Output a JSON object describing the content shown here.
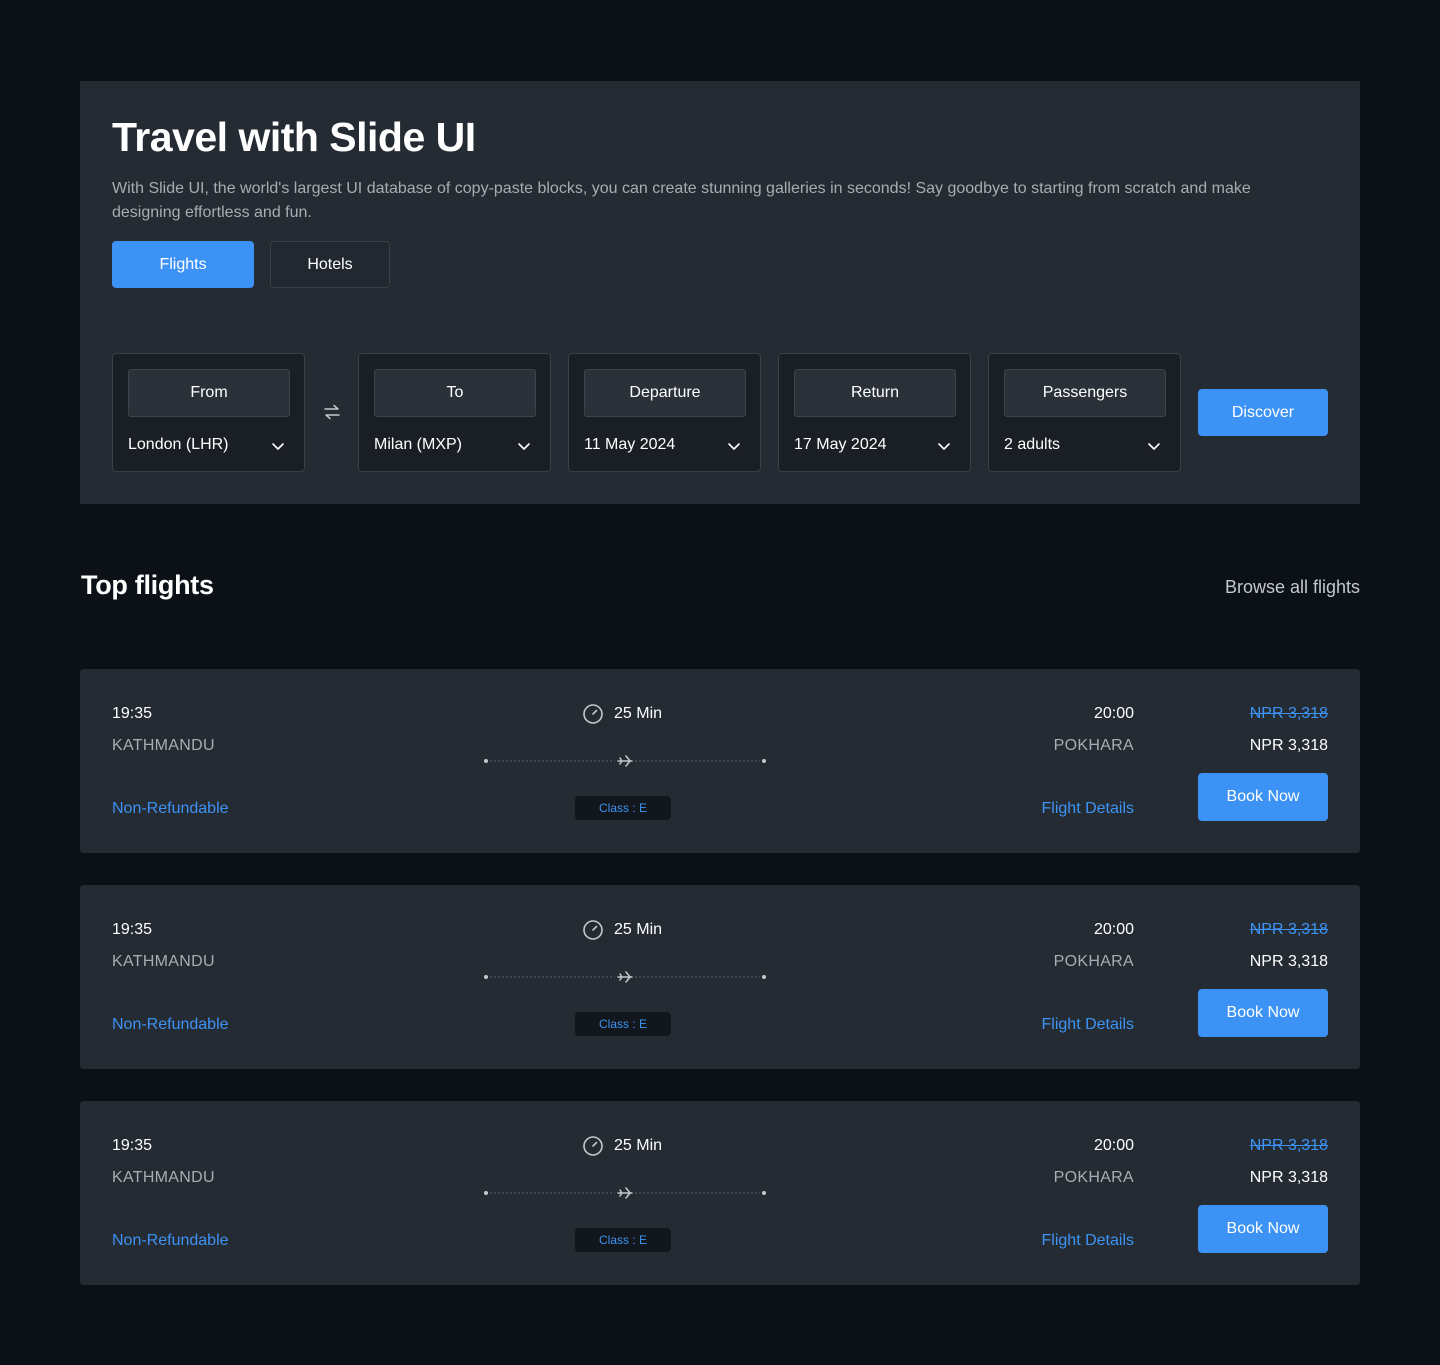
{
  "hero": {
    "title": "Travel with Slide UI",
    "description": "With Slide UI, the world's largest UI database of copy-paste blocks, you can create stunning galleries in seconds! Say goodbye to starting from scratch and make designing effortless and fun.",
    "tabs": [
      {
        "label": "Flights",
        "active": true
      },
      {
        "label": "Hotels",
        "active": false
      }
    ]
  },
  "search": {
    "fields": [
      {
        "label": "From",
        "value": "London (LHR)"
      },
      {
        "label": "To",
        "value": "Milan (MXP)"
      },
      {
        "label": "Departure",
        "value": "11 May 2024"
      },
      {
        "label": "Return",
        "value": "17 May 2024"
      },
      {
        "label": "Passengers",
        "value": "2 adults"
      }
    ],
    "swap_icon": "swap-arrows-icon",
    "discover_label": "Discover"
  },
  "top_flights": {
    "title": "Top flights",
    "browse_label": "Browse all flights",
    "flights": [
      {
        "departure_time": "19:35",
        "departure_city": "KATHMANDU",
        "duration": "25 Min",
        "class": "Class : E",
        "refund": "Non-Refundable",
        "arrival_time": "20:00",
        "arrival_city": "POKHARA",
        "details_label": "Flight Details",
        "old_price": "NPR 3,318",
        "price": "NPR 3,318",
        "book_label": "Book Now"
      },
      {
        "departure_time": "19:35",
        "departure_city": "KATHMANDU",
        "duration": "25 Min",
        "class": "Class : E",
        "refund": "Non-Refundable",
        "arrival_time": "20:00",
        "arrival_city": "POKHARA",
        "details_label": "Flight Details",
        "old_price": "NPR 3,318",
        "price": "NPR 3,318",
        "book_label": "Book Now"
      },
      {
        "departure_time": "19:35",
        "departure_city": "KATHMANDU",
        "duration": "25 Min",
        "class": "Class : E",
        "refund": "Non-Refundable",
        "arrival_time": "20:00",
        "arrival_city": "POKHARA",
        "details_label": "Flight Details",
        "old_price": "NPR 3,318",
        "price": "NPR 3,318",
        "book_label": "Book Now"
      }
    ]
  },
  "colors": {
    "background": "#0c1118",
    "panel": "#252b32",
    "accent": "#3d93f5",
    "muted_text": "#a7adb4"
  }
}
